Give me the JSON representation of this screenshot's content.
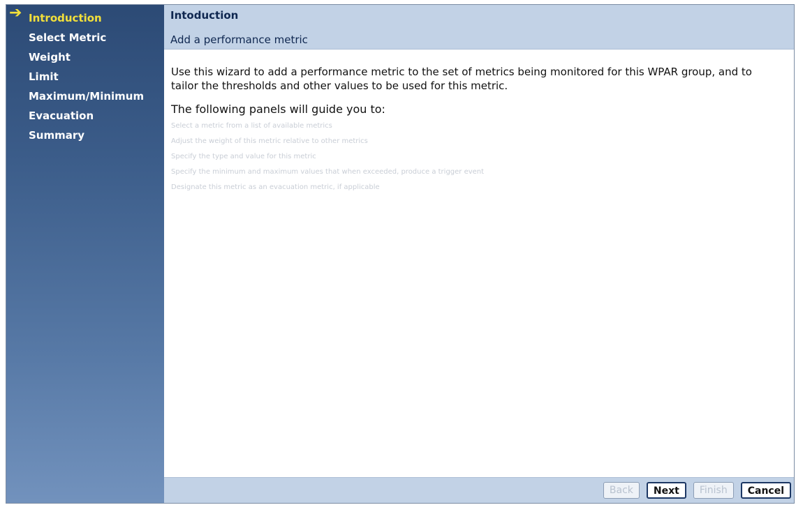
{
  "nav": {
    "items": [
      {
        "label": "Introduction",
        "current": true
      },
      {
        "label": "Select Metric"
      },
      {
        "label": "Weight"
      },
      {
        "label": "Limit"
      },
      {
        "label": "Maximum/Minimum"
      },
      {
        "label": "Evacuation"
      },
      {
        "label": "Summary"
      }
    ],
    "current_icon": "arrow-right-icon"
  },
  "header": {
    "title": "Intoduction",
    "subtitle": "Add a performance metric"
  },
  "content": {
    "intro": "Use this wizard to add a performance metric to the set of metrics being monitored for this WPAR group, and to tailor the thresholds and other values to be used for this metric.",
    "guide_heading": "The following panels will guide you to:",
    "steps": [
      "Select a metric from a list of available metrics",
      "Adjust the weight of this metric relative to other metrics",
      "Specify the type and value for this metric",
      "Specify the minimum and maximum values that when exceeded, produce a trigger event",
      "Designate this metric as an evacuation metric, if applicable"
    ]
  },
  "footer": {
    "back": "Back",
    "next": "Next",
    "finish": "Finish",
    "cancel": "Cancel"
  },
  "colors": {
    "nav_top": "#2c4a75",
    "nav_bottom": "#7292bd",
    "current_item": "#f3e03a",
    "header_bg": "#c2d2e6"
  }
}
